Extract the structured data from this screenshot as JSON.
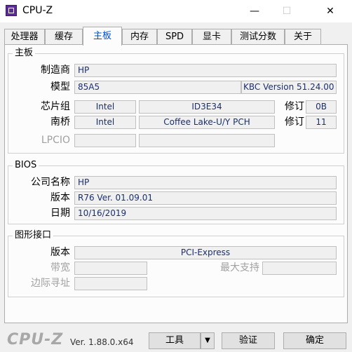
{
  "window": {
    "title": "CPU-Z",
    "minimize_icon": "—",
    "maximize_icon": "☐",
    "close_icon": "✕"
  },
  "tabs": [
    {
      "label": "处理器"
    },
    {
      "label": "缓存"
    },
    {
      "label": "主板"
    },
    {
      "label": "内存"
    },
    {
      "label": "SPD"
    },
    {
      "label": "显卡"
    },
    {
      "label": "测试分数"
    },
    {
      "label": "关于"
    }
  ],
  "active_tab": "主板",
  "mainboard": {
    "section_title": "主板",
    "manufacturer_label": "制造商",
    "manufacturer": "HP",
    "model_label": "模型",
    "model": "85A5",
    "model_extra": "KBC Version 51.24.00",
    "chipset_label": "芯片组",
    "chipset_vendor": "Intel",
    "chipset_model": "ID3E34",
    "chipset_rev_label": "修订",
    "chipset_rev": "0B",
    "southbridge_label": "南桥",
    "southbridge_vendor": "Intel",
    "southbridge_model": "Coffee Lake-U/Y PCH",
    "southbridge_rev_label": "修订",
    "southbridge_rev": "11",
    "lpcio_label": "LPCIO",
    "lpcio_vendor": "",
    "lpcio_model": ""
  },
  "bios": {
    "section_title": "BIOS",
    "brand_label": "公司名称",
    "brand": "HP",
    "version_label": "版本",
    "version": "R76 Ver. 01.09.01",
    "date_label": "日期",
    "date": "10/16/2019"
  },
  "graphic_interface": {
    "section_title": "图形接口",
    "version_label": "版本",
    "version": "PCI-Express",
    "link_width_label": "带宽",
    "link_width": "",
    "max_supported_label": "最大支持",
    "max_supported": "",
    "sideband_label": "边际寻址",
    "sideband": ""
  },
  "footer": {
    "logo": "CPU-Z",
    "version": "Ver. 1.88.0.x64",
    "tools_label": "工具",
    "tools_arrow": "▼",
    "validate_label": "验证",
    "ok_label": "确定"
  }
}
